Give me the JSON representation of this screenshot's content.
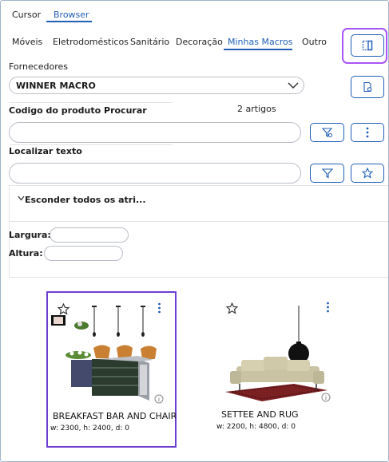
{
  "top_tabs": [
    {
      "label": "Cursor",
      "active": false
    },
    {
      "label": "Browser",
      "active": true
    }
  ],
  "categories": [
    {
      "label": "Móveis",
      "active": false
    },
    {
      "label": "Eletrodomésticos",
      "active": false
    },
    {
      "label": "Sanitário",
      "active": false
    },
    {
      "label": "Decoração",
      "active": false
    },
    {
      "label": "Minhas Macros",
      "active": true
    },
    {
      "label": "Outro",
      "active": false
    }
  ],
  "supplier": {
    "label": "Fornecedores",
    "selected": "WINNER MACRO"
  },
  "product_code": {
    "label": "Codigo do produto Procurar",
    "count": "2 artigos",
    "value": ""
  },
  "locate_text": {
    "label": "Localizar texto",
    "value": ""
  },
  "attributes": {
    "toggle_label": "Esconder todos os atri..."
  },
  "dimensions": {
    "width_label": "Largura:",
    "height_label": "Altura:",
    "width_value": "",
    "height_value": ""
  },
  "products": [
    {
      "name": "BREAKFAST BAR AND CHAIRS",
      "dims": "w: 2300, h: 2400, d: 0",
      "selected": true
    },
    {
      "name": "SETTEE AND RUG",
      "dims": "w: 2200, h: 4800, d: 0",
      "selected": false
    }
  ],
  "colors": {
    "accent": "#1f5fb8",
    "highlight": "#a855f7",
    "selection": "#6d3fd1"
  }
}
